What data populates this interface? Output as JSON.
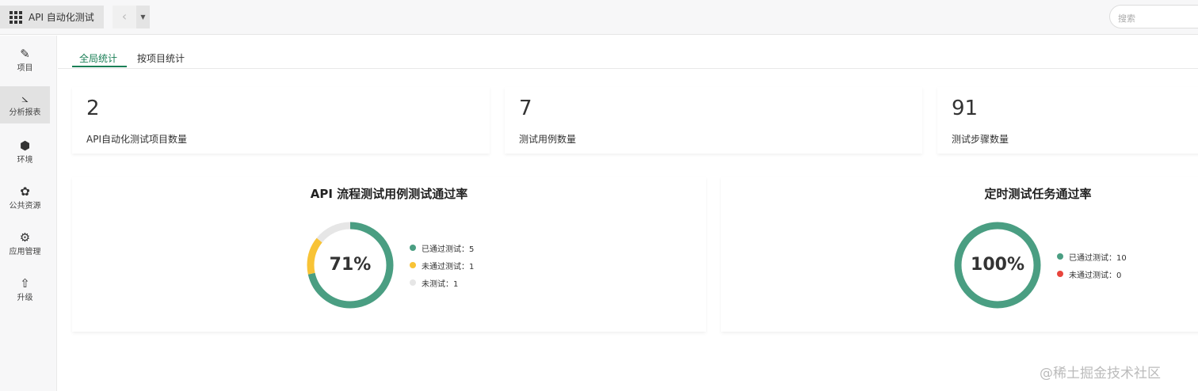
{
  "header": {
    "app_title": "API 自动化测试",
    "back_icon": "chevron-left",
    "search_placeholder": "搜索"
  },
  "sidebar": {
    "items": [
      {
        "label": "项目",
        "icon": "pencil-ruler"
      },
      {
        "label": "分析报表",
        "icon": "chart-line",
        "active": true
      },
      {
        "label": "环境",
        "icon": "cube"
      },
      {
        "label": "公共资源",
        "icon": "puzzle"
      },
      {
        "label": "应用管理",
        "icon": "gear"
      },
      {
        "label": "升级",
        "icon": "rocket"
      }
    ]
  },
  "tabs": [
    {
      "label": "全局统计",
      "active": true
    },
    {
      "label": "按项目统计"
    }
  ],
  "stats": [
    {
      "value": "2",
      "label": "API自动化测试项目数量"
    },
    {
      "value": "7",
      "label": "测试用例数量"
    },
    {
      "value": "91",
      "label": "测试步骤数量"
    }
  ],
  "colors": {
    "passed": "#4a9e82",
    "failed": "#f8c336",
    "untested": "#e6e6e6",
    "failed_red": "#e8453c",
    "accent": "#1a7f56"
  },
  "chart_data": [
    {
      "type": "pie",
      "title": "API 流程测试用例测试通过率",
      "center_label": "71%",
      "series": [
        {
          "name": "已通过测试",
          "label": "已通过测试：5",
          "value": 5,
          "color": "#4a9e82"
        },
        {
          "name": "未通过测试",
          "label": "未通过测试：1",
          "value": 1,
          "color": "#f8c336"
        },
        {
          "name": "未测试",
          "label": "未测试：1",
          "value": 1,
          "color": "#e6e6e6"
        }
      ]
    },
    {
      "type": "pie",
      "title": "定时测试任务通过率",
      "center_label": "100%",
      "series": [
        {
          "name": "已通过测试",
          "label": "已通过测试：10",
          "value": 10,
          "color": "#4a9e82"
        },
        {
          "name": "未通过测试",
          "label": "未通过测试：0",
          "value": 0,
          "color": "#e8453c"
        }
      ]
    }
  ],
  "watermark": "@稀土掘金技术社区"
}
